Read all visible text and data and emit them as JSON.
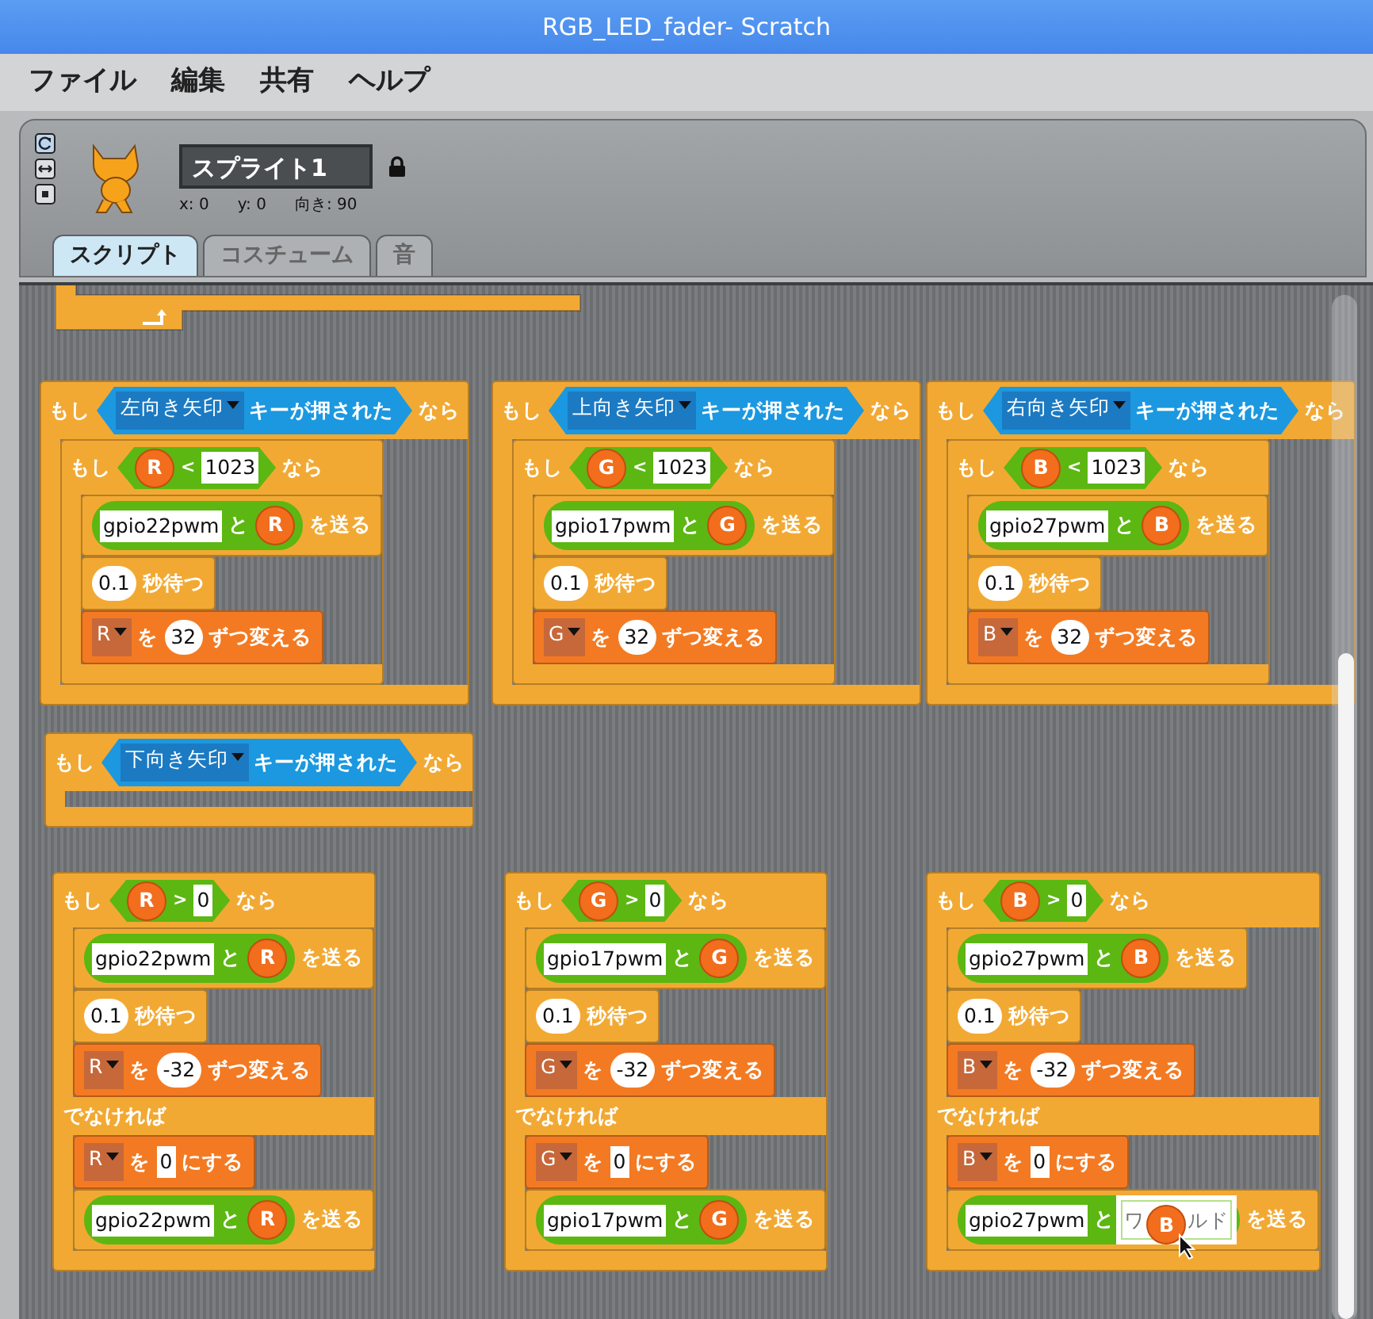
{
  "window": {
    "title": "RGB_LED_fader- Scratch"
  },
  "menu": [
    "ファイル",
    "編集",
    "共有",
    "ヘルプ"
  ],
  "sprite": {
    "name": "スプライト1",
    "x": "x: 0",
    "y": "y: 0",
    "direction": "向き: 90"
  },
  "tabs": [
    {
      "label": "スクリプト",
      "selected": true
    },
    {
      "label": "コスチューム",
      "selected": false
    },
    {
      "label": "音",
      "selected": false
    }
  ],
  "scripts": [
    {
      "kind": "loop-end"
    },
    {
      "kind": "if",
      "parts": [
        {
          "kind": "label",
          "text": "もし"
        },
        {
          "kind": "key",
          "parts": [
            {
              "kind": "dropdown",
              "text": "左向き矢印"
            },
            {
              "kind": "label",
              "text": "キーが押された"
            }
          ]
        },
        {
          "kind": "label",
          "text": "なら"
        }
      ],
      "body": [
        {
          "kind": "if",
          "parts": [
            {
              "kind": "label",
              "text": "もし"
            },
            {
              "kind": "compare",
              "parts": [
                {
                  "kind": "var",
                  "text": "R"
                },
                {
                  "kind": "op",
                  "text": "<"
                },
                {
                  "kind": "field",
                  "text": "1023"
                }
              ]
            },
            {
              "kind": "label",
              "text": "なら"
            }
          ],
          "body": [
            {
              "kind": "send",
              "parts": [
                {
                  "kind": "join",
                  "parts": [
                    {
                      "kind": "field",
                      "text": "gpio22pwm"
                    },
                    {
                      "kind": "label",
                      "text": "と"
                    },
                    {
                      "kind": "var",
                      "text": "R"
                    }
                  ]
                },
                {
                  "kind": "label",
                  "text": "を送る"
                }
              ]
            },
            {
              "kind": "wait",
              "parts": [
                {
                  "kind": "number",
                  "text": "0.1"
                },
                {
                  "kind": "label",
                  "text": "秒待つ"
                }
              ]
            },
            {
              "kind": "change",
              "parts": [
                {
                  "kind": "dropdown",
                  "text": "R"
                },
                {
                  "kind": "label",
                  "text": "を"
                },
                {
                  "kind": "number",
                  "text": "32"
                },
                {
                  "kind": "label",
                  "text": "ずつ変える"
                }
              ]
            }
          ]
        }
      ]
    },
    {
      "kind": "if",
      "parts": [
        {
          "kind": "label",
          "text": "もし"
        },
        {
          "kind": "key",
          "parts": [
            {
              "kind": "dropdown",
              "text": "上向き矢印"
            },
            {
              "kind": "label",
              "text": "キーが押された"
            }
          ]
        },
        {
          "kind": "label",
          "text": "なら"
        }
      ],
      "body": [
        {
          "kind": "if",
          "parts": [
            {
              "kind": "label",
              "text": "もし"
            },
            {
              "kind": "compare",
              "parts": [
                {
                  "kind": "var",
                  "text": "G"
                },
                {
                  "kind": "op",
                  "text": "<"
                },
                {
                  "kind": "field",
                  "text": "1023"
                }
              ]
            },
            {
              "kind": "label",
              "text": "なら"
            }
          ],
          "body": [
            {
              "kind": "send",
              "parts": [
                {
                  "kind": "join",
                  "parts": [
                    {
                      "kind": "field",
                      "text": "gpio17pwm"
                    },
                    {
                      "kind": "label",
                      "text": "と"
                    },
                    {
                      "kind": "var",
                      "text": "G"
                    }
                  ]
                },
                {
                  "kind": "label",
                  "text": "を送る"
                }
              ]
            },
            {
              "kind": "wait",
              "parts": [
                {
                  "kind": "number",
                  "text": "0.1"
                },
                {
                  "kind": "label",
                  "text": "秒待つ"
                }
              ]
            },
            {
              "kind": "change",
              "parts": [
                {
                  "kind": "dropdown",
                  "text": "G"
                },
                {
                  "kind": "label",
                  "text": "を"
                },
                {
                  "kind": "number",
                  "text": "32"
                },
                {
                  "kind": "label",
                  "text": "ずつ変える"
                }
              ]
            }
          ]
        }
      ]
    },
    {
      "kind": "if",
      "parts": [
        {
          "kind": "label",
          "text": "もし"
        },
        {
          "kind": "key",
          "parts": [
            {
              "kind": "dropdown",
              "text": "右向き矢印"
            },
            {
              "kind": "label",
              "text": "キーが押された"
            }
          ]
        },
        {
          "kind": "label",
          "text": "なら"
        }
      ],
      "body": [
        {
          "kind": "if",
          "parts": [
            {
              "kind": "label",
              "text": "もし"
            },
            {
              "kind": "compare",
              "parts": [
                {
                  "kind": "var",
                  "text": "B"
                },
                {
                  "kind": "op",
                  "text": "<"
                },
                {
                  "kind": "field",
                  "text": "1023"
                }
              ]
            },
            {
              "kind": "label",
              "text": "なら"
            }
          ],
          "body": [
            {
              "kind": "send",
              "parts": [
                {
                  "kind": "join",
                  "parts": [
                    {
                      "kind": "field",
                      "text": "gpio27pwm"
                    },
                    {
                      "kind": "label",
                      "text": "と"
                    },
                    {
                      "kind": "var",
                      "text": "B"
                    }
                  ]
                },
                {
                  "kind": "label",
                  "text": "を送る"
                }
              ]
            },
            {
              "kind": "wait",
              "parts": [
                {
                  "kind": "number",
                  "text": "0.1"
                },
                {
                  "kind": "label",
                  "text": "秒待つ"
                }
              ]
            },
            {
              "kind": "change",
              "parts": [
                {
                  "kind": "dropdown",
                  "text": "B"
                },
                {
                  "kind": "label",
                  "text": "を"
                },
                {
                  "kind": "number",
                  "text": "32"
                },
                {
                  "kind": "label",
                  "text": "ずつ変える"
                }
              ]
            }
          ]
        }
      ]
    },
    {
      "kind": "if",
      "parts": [
        {
          "kind": "label",
          "text": "もし"
        },
        {
          "kind": "key",
          "parts": [
            {
              "kind": "dropdown",
              "text": "下向き矢印"
            },
            {
              "kind": "label",
              "text": "キーが押された"
            }
          ]
        },
        {
          "kind": "label",
          "text": "なら"
        }
      ]
    },
    {
      "kind": "if",
      "parts": [
        {
          "kind": "label",
          "text": "もし"
        },
        {
          "kind": "compare",
          "parts": [
            {
              "kind": "var",
              "text": "R"
            },
            {
              "kind": "op",
              "text": ">"
            },
            {
              "kind": "field",
              "text": "0"
            }
          ]
        },
        {
          "kind": "label",
          "text": "なら"
        }
      ],
      "body": [
        {
          "kind": "send",
          "parts": [
            {
              "kind": "join",
              "parts": [
                {
                  "kind": "field",
                  "text": "gpio22pwm"
                },
                {
                  "kind": "label",
                  "text": "と"
                },
                {
                  "kind": "var",
                  "text": "R"
                }
              ]
            },
            {
              "kind": "label",
              "text": "を送る"
            }
          ]
        },
        {
          "kind": "wait",
          "parts": [
            {
              "kind": "number",
              "text": "0.1"
            },
            {
              "kind": "label",
              "text": "秒待つ"
            }
          ]
        },
        {
          "kind": "change",
          "parts": [
            {
              "kind": "dropdown",
              "text": "R"
            },
            {
              "kind": "label",
              "text": "を"
            },
            {
              "kind": "number",
              "text": "-32"
            },
            {
              "kind": "label",
              "text": "ずつ変える"
            }
          ]
        }
      ],
      "else_label": "でなければ",
      "else_body": [
        {
          "kind": "set",
          "parts": [
            {
              "kind": "dropdown",
              "text": "R"
            },
            {
              "kind": "label",
              "text": "を"
            },
            {
              "kind": "field",
              "text": "0"
            },
            {
              "kind": "label",
              "text": "にする"
            }
          ]
        },
        {
          "kind": "send",
          "parts": [
            {
              "kind": "join",
              "parts": [
                {
                  "kind": "field",
                  "text": "gpio22pwm"
                },
                {
                  "kind": "label",
                  "text": "と"
                },
                {
                  "kind": "var",
                  "text": "R"
                }
              ]
            },
            {
              "kind": "label",
              "text": "を送る"
            }
          ]
        }
      ]
    },
    {
      "kind": "if",
      "parts": [
        {
          "kind": "label",
          "text": "もし"
        },
        {
          "kind": "compare",
          "parts": [
            {
              "kind": "var",
              "text": "G"
            },
            {
              "kind": "op",
              "text": ">"
            },
            {
              "kind": "field",
              "text": "0"
            }
          ]
        },
        {
          "kind": "label",
          "text": "なら"
        }
      ],
      "body": [
        {
          "kind": "send",
          "parts": [
            {
              "kind": "join",
              "parts": [
                {
                  "kind": "field",
                  "text": "gpio17pwm"
                },
                {
                  "kind": "label",
                  "text": "と"
                },
                {
                  "kind": "var",
                  "text": "G"
                }
              ]
            },
            {
              "kind": "label",
              "text": "を送る"
            }
          ]
        },
        {
          "kind": "wait",
          "parts": [
            {
              "kind": "number",
              "text": "0.1"
            },
            {
              "kind": "label",
              "text": "秒待つ"
            }
          ]
        },
        {
          "kind": "change",
          "parts": [
            {
              "kind": "dropdown",
              "text": "G"
            },
            {
              "kind": "label",
              "text": "を"
            },
            {
              "kind": "number",
              "text": "-32"
            },
            {
              "kind": "label",
              "text": "ずつ変える"
            }
          ]
        }
      ],
      "else_label": "でなければ",
      "else_body": [
        {
          "kind": "set",
          "parts": [
            {
              "kind": "dropdown",
              "text": "G"
            },
            {
              "kind": "label",
              "text": "を"
            },
            {
              "kind": "field",
              "text": "0"
            },
            {
              "kind": "label",
              "text": "にする"
            }
          ]
        },
        {
          "kind": "send",
          "parts": [
            {
              "kind": "join",
              "parts": [
                {
                  "kind": "field",
                  "text": "gpio17pwm"
                },
                {
                  "kind": "label",
                  "text": "と"
                },
                {
                  "kind": "var",
                  "text": "G"
                }
              ]
            },
            {
              "kind": "label",
              "text": "を送る"
            }
          ]
        }
      ]
    },
    {
      "kind": "if",
      "parts": [
        {
          "kind": "label",
          "text": "もし"
        },
        {
          "kind": "compare",
          "parts": [
            {
              "kind": "var",
              "text": "B"
            },
            {
              "kind": "op",
              "text": ">"
            },
            {
              "kind": "field",
              "text": "0"
            }
          ]
        },
        {
          "kind": "label",
          "text": "なら"
        }
      ],
      "body": [
        {
          "kind": "send",
          "parts": [
            {
              "kind": "join",
              "parts": [
                {
                  "kind": "field",
                  "text": "gpio27pwm"
                },
                {
                  "kind": "label",
                  "text": "と"
                },
                {
                  "kind": "var",
                  "text": "B"
                }
              ]
            },
            {
              "kind": "label",
              "text": "を送る"
            }
          ]
        },
        {
          "kind": "wait",
          "parts": [
            {
              "kind": "number",
              "text": "0.1"
            },
            {
              "kind": "label",
              "text": "秒待つ"
            }
          ]
        },
        {
          "kind": "change",
          "parts": [
            {
              "kind": "dropdown",
              "text": "B"
            },
            {
              "kind": "label",
              "text": "を"
            },
            {
              "kind": "number",
              "text": "-32"
            },
            {
              "kind": "label",
              "text": "ずつ変える"
            }
          ]
        }
      ],
      "else_label": "でなければ",
      "else_body": [
        {
          "kind": "set",
          "parts": [
            {
              "kind": "dropdown",
              "text": "B"
            },
            {
              "kind": "label",
              "text": "を"
            },
            {
              "kind": "field",
              "text": "0"
            },
            {
              "kind": "label",
              "text": "にする"
            }
          ]
        },
        {
          "kind": "send",
          "parts": [
            {
              "kind": "join",
              "parts": [
                {
                  "kind": "field",
                  "text": "gpio27pwm"
                },
                {
                  "kind": "label",
                  "text": "と"
                },
                {
                  "kind": "field",
                  "texts": [
                    "ワ",
                    "ルド"
                  ],
                  "drop_highlight": true,
                  "covered_by": {
                    "kind": "var",
                    "text": "B"
                  }
                }
              ]
            },
            {
              "kind": "label",
              "text": "を送る"
            }
          ]
        }
      ]
    }
  ]
}
